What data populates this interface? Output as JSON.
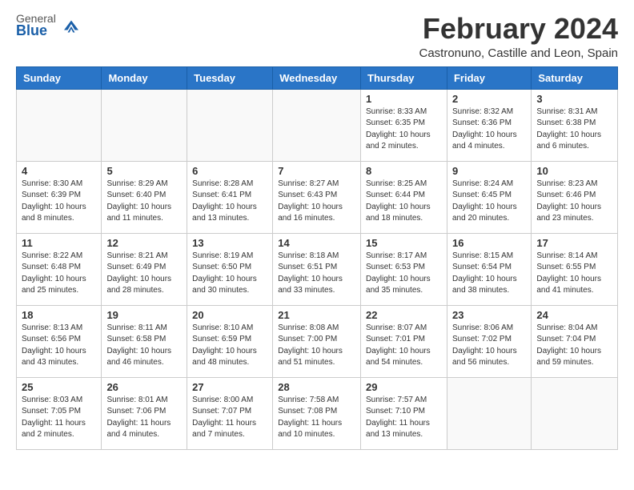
{
  "logo": {
    "general": "General",
    "blue": "Blue"
  },
  "header": {
    "month": "February 2024",
    "location": "Castronuno, Castille and Leon, Spain"
  },
  "weekdays": [
    "Sunday",
    "Monday",
    "Tuesday",
    "Wednesday",
    "Thursday",
    "Friday",
    "Saturday"
  ],
  "weeks": [
    [
      {
        "day": "",
        "sunrise": "",
        "sunset": "",
        "daylight": ""
      },
      {
        "day": "",
        "sunrise": "",
        "sunset": "",
        "daylight": ""
      },
      {
        "day": "",
        "sunrise": "",
        "sunset": "",
        "daylight": ""
      },
      {
        "day": "",
        "sunrise": "",
        "sunset": "",
        "daylight": ""
      },
      {
        "day": "1",
        "sunrise": "Sunrise: 8:33 AM",
        "sunset": "Sunset: 6:35 PM",
        "daylight": "Daylight: 10 hours and 2 minutes."
      },
      {
        "day": "2",
        "sunrise": "Sunrise: 8:32 AM",
        "sunset": "Sunset: 6:36 PM",
        "daylight": "Daylight: 10 hours and 4 minutes."
      },
      {
        "day": "3",
        "sunrise": "Sunrise: 8:31 AM",
        "sunset": "Sunset: 6:38 PM",
        "daylight": "Daylight: 10 hours and 6 minutes."
      }
    ],
    [
      {
        "day": "4",
        "sunrise": "Sunrise: 8:30 AM",
        "sunset": "Sunset: 6:39 PM",
        "daylight": "Daylight: 10 hours and 8 minutes."
      },
      {
        "day": "5",
        "sunrise": "Sunrise: 8:29 AM",
        "sunset": "Sunset: 6:40 PM",
        "daylight": "Daylight: 10 hours and 11 minutes."
      },
      {
        "day": "6",
        "sunrise": "Sunrise: 8:28 AM",
        "sunset": "Sunset: 6:41 PM",
        "daylight": "Daylight: 10 hours and 13 minutes."
      },
      {
        "day": "7",
        "sunrise": "Sunrise: 8:27 AM",
        "sunset": "Sunset: 6:43 PM",
        "daylight": "Daylight: 10 hours and 16 minutes."
      },
      {
        "day": "8",
        "sunrise": "Sunrise: 8:25 AM",
        "sunset": "Sunset: 6:44 PM",
        "daylight": "Daylight: 10 hours and 18 minutes."
      },
      {
        "day": "9",
        "sunrise": "Sunrise: 8:24 AM",
        "sunset": "Sunset: 6:45 PM",
        "daylight": "Daylight: 10 hours and 20 minutes."
      },
      {
        "day": "10",
        "sunrise": "Sunrise: 8:23 AM",
        "sunset": "Sunset: 6:46 PM",
        "daylight": "Daylight: 10 hours and 23 minutes."
      }
    ],
    [
      {
        "day": "11",
        "sunrise": "Sunrise: 8:22 AM",
        "sunset": "Sunset: 6:48 PM",
        "daylight": "Daylight: 10 hours and 25 minutes."
      },
      {
        "day": "12",
        "sunrise": "Sunrise: 8:21 AM",
        "sunset": "Sunset: 6:49 PM",
        "daylight": "Daylight: 10 hours and 28 minutes."
      },
      {
        "day": "13",
        "sunrise": "Sunrise: 8:19 AM",
        "sunset": "Sunset: 6:50 PM",
        "daylight": "Daylight: 10 hours and 30 minutes."
      },
      {
        "day": "14",
        "sunrise": "Sunrise: 8:18 AM",
        "sunset": "Sunset: 6:51 PM",
        "daylight": "Daylight: 10 hours and 33 minutes."
      },
      {
        "day": "15",
        "sunrise": "Sunrise: 8:17 AM",
        "sunset": "Sunset: 6:53 PM",
        "daylight": "Daylight: 10 hours and 35 minutes."
      },
      {
        "day": "16",
        "sunrise": "Sunrise: 8:15 AM",
        "sunset": "Sunset: 6:54 PM",
        "daylight": "Daylight: 10 hours and 38 minutes."
      },
      {
        "day": "17",
        "sunrise": "Sunrise: 8:14 AM",
        "sunset": "Sunset: 6:55 PM",
        "daylight": "Daylight: 10 hours and 41 minutes."
      }
    ],
    [
      {
        "day": "18",
        "sunrise": "Sunrise: 8:13 AM",
        "sunset": "Sunset: 6:56 PM",
        "daylight": "Daylight: 10 hours and 43 minutes."
      },
      {
        "day": "19",
        "sunrise": "Sunrise: 8:11 AM",
        "sunset": "Sunset: 6:58 PM",
        "daylight": "Daylight: 10 hours and 46 minutes."
      },
      {
        "day": "20",
        "sunrise": "Sunrise: 8:10 AM",
        "sunset": "Sunset: 6:59 PM",
        "daylight": "Daylight: 10 hours and 48 minutes."
      },
      {
        "day": "21",
        "sunrise": "Sunrise: 8:08 AM",
        "sunset": "Sunset: 7:00 PM",
        "daylight": "Daylight: 10 hours and 51 minutes."
      },
      {
        "day": "22",
        "sunrise": "Sunrise: 8:07 AM",
        "sunset": "Sunset: 7:01 PM",
        "daylight": "Daylight: 10 hours and 54 minutes."
      },
      {
        "day": "23",
        "sunrise": "Sunrise: 8:06 AM",
        "sunset": "Sunset: 7:02 PM",
        "daylight": "Daylight: 10 hours and 56 minutes."
      },
      {
        "day": "24",
        "sunrise": "Sunrise: 8:04 AM",
        "sunset": "Sunset: 7:04 PM",
        "daylight": "Daylight: 10 hours and 59 minutes."
      }
    ],
    [
      {
        "day": "25",
        "sunrise": "Sunrise: 8:03 AM",
        "sunset": "Sunset: 7:05 PM",
        "daylight": "Daylight: 11 hours and 2 minutes."
      },
      {
        "day": "26",
        "sunrise": "Sunrise: 8:01 AM",
        "sunset": "Sunset: 7:06 PM",
        "daylight": "Daylight: 11 hours and 4 minutes."
      },
      {
        "day": "27",
        "sunrise": "Sunrise: 8:00 AM",
        "sunset": "Sunset: 7:07 PM",
        "daylight": "Daylight: 11 hours and 7 minutes."
      },
      {
        "day": "28",
        "sunrise": "Sunrise: 7:58 AM",
        "sunset": "Sunset: 7:08 PM",
        "daylight": "Daylight: 11 hours and 10 minutes."
      },
      {
        "day": "29",
        "sunrise": "Sunrise: 7:57 AM",
        "sunset": "Sunset: 7:10 PM",
        "daylight": "Daylight: 11 hours and 13 minutes."
      },
      {
        "day": "",
        "sunrise": "",
        "sunset": "",
        "daylight": ""
      },
      {
        "day": "",
        "sunrise": "",
        "sunset": "",
        "daylight": ""
      }
    ]
  ]
}
